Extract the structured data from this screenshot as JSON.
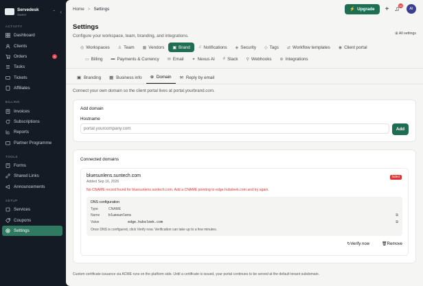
{
  "sidebar": {
    "org_name": "Servedesk",
    "org_sub": "Owner",
    "sections": [
      {
        "label": "ACTIVITY",
        "items": [
          {
            "label": "Dashboard",
            "icon": "grid-icon"
          },
          {
            "label": "Clients",
            "icon": "users-icon"
          },
          {
            "label": "Orders",
            "icon": "cart-icon",
            "badge": "4"
          },
          {
            "label": "Tasks",
            "icon": "tasks-icon"
          },
          {
            "label": "Tickets",
            "icon": "ticket-icon"
          },
          {
            "label": "Affiliates",
            "icon": "affiliate-icon"
          }
        ]
      },
      {
        "label": "BILLING",
        "items": [
          {
            "label": "Invoices",
            "icon": "invoice-icon"
          },
          {
            "label": "Subscriptions",
            "icon": "refresh-icon"
          },
          {
            "label": "Reports",
            "icon": "chart-icon"
          },
          {
            "label": "Partner Programme",
            "icon": "partner-icon"
          }
        ]
      },
      {
        "label": "TOOLS",
        "items": [
          {
            "label": "Forms",
            "icon": "forms-icon"
          },
          {
            "label": "Shared Links",
            "icon": "link-icon"
          },
          {
            "label": "Announcements",
            "icon": "megaphone-icon"
          }
        ]
      },
      {
        "label": "SETUP",
        "items": [
          {
            "label": "Services",
            "icon": "box-icon"
          },
          {
            "label": "Coupons",
            "icon": "tag-icon"
          },
          {
            "label": "Settings",
            "icon": "gear-icon",
            "active": true
          }
        ]
      }
    ]
  },
  "topbar": {
    "breadcrumb_home": "Home",
    "breadcrumb_sep": ">",
    "breadcrumb_current": "Settings",
    "upgrade_label": "Upgrade",
    "notification_count": "10",
    "avatar_initials": "AI"
  },
  "header": {
    "title": "Settings",
    "subtitle": "Configure your workspace, team, branding, and integrations.",
    "all_settings": "All settings"
  },
  "tabs_row1": [
    {
      "label": "Workspaces",
      "icon": "◎"
    },
    {
      "label": "Team",
      "icon": "♙"
    },
    {
      "label": "Vendors",
      "icon": "▦"
    },
    {
      "label": "Brand",
      "icon": "▣",
      "active": true
    },
    {
      "label": "Notifications",
      "icon": "♫"
    },
    {
      "label": "Security",
      "icon": "◈"
    },
    {
      "label": "Tags",
      "icon": "◇"
    },
    {
      "label": "Workflow templates",
      "icon": "⇄"
    },
    {
      "label": "Client portal",
      "icon": "◉"
    }
  ],
  "tabs_row2": [
    {
      "label": "Billing",
      "icon": "▭"
    },
    {
      "label": "Payments & Currency",
      "icon": "▬"
    },
    {
      "label": "Email",
      "icon": "✉"
    },
    {
      "label": "Nexus AI",
      "icon": "✦"
    },
    {
      "label": "Slack",
      "icon": "#"
    },
    {
      "label": "Webhooks",
      "icon": "⚲"
    },
    {
      "label": "Integrations",
      "icon": "⊕"
    }
  ],
  "subtabs": [
    {
      "label": "Branding",
      "icon": "▣"
    },
    {
      "label": "Business info",
      "icon": "▦"
    },
    {
      "label": "Domain",
      "icon": "⊕",
      "active": true
    },
    {
      "label": "Reply by email",
      "icon": "✉"
    }
  ],
  "description": "Connect your own domain so the client portal lives at portal.yourbrand.com.",
  "add_domain": {
    "title": "Add domain",
    "hostname_label": "Hostname",
    "placeholder": "portal.yourcompany.com",
    "button": "Add"
  },
  "connected": {
    "title": "Connected domains",
    "domain": "bluesunlens.suntech.com",
    "added": "Added Sep 16, 2026",
    "status": "failed",
    "error": "No CNAME record found for bluesunlens.suntech.com. Add a CNAME pointing to edge.hubsleek.com and try again.",
    "dns_title": "DNS configuration",
    "dns_type_key": "Type",
    "dns_type_val": "CNAME",
    "dns_name_key": "Name",
    "dns_name_val": "bluesunlens",
    "dns_value_key": "Value",
    "dns_value_val": "edge.hubsleek.com",
    "dns_note": "Once DNS is configured, click Verify now. Verification can take up to a few minutes.",
    "verify_label": "Verify now",
    "remove_label": "Remove"
  },
  "footer": "Custom certificate issuance via ACME runs on the platform side. Until a certificate is issued, your portal continues to be served at the default tenant subdomain."
}
